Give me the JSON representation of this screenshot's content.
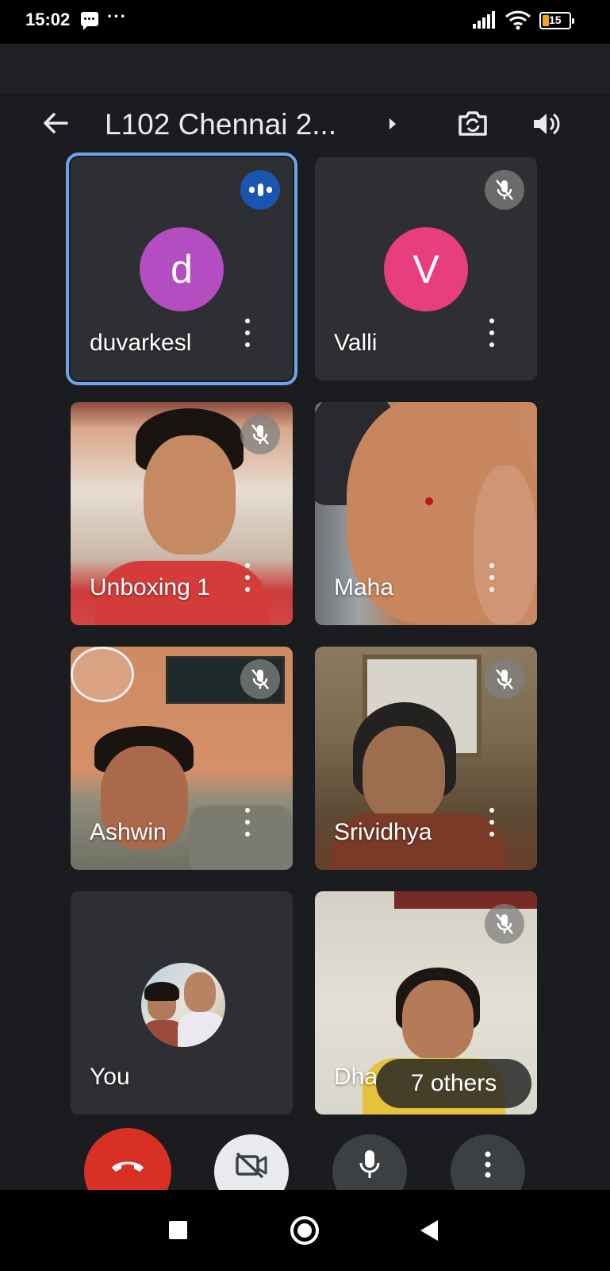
{
  "status_bar": {
    "time": "15:02",
    "battery_level": "15",
    "battery_color": "#f5a623"
  },
  "header": {
    "title": "L102 Chennai 2...",
    "back_icon": "arrow-left-icon",
    "switch_camera_icon": "switch-camera-icon",
    "speaker_icon": "volume-icon"
  },
  "participants": [
    {
      "name": "duvarkesl",
      "avatar_letter": "d",
      "avatar_color": "#b34dc1",
      "status": "speaking",
      "active": true
    },
    {
      "name": "Valli",
      "avatar_letter": "V",
      "avatar_color": "#e83e7b",
      "status": "muted"
    },
    {
      "name": "Unboxing 1",
      "status": "muted",
      "video": true
    },
    {
      "name": "Maha",
      "status": "unmuted",
      "video": true
    },
    {
      "name": "Ashwin",
      "status": "muted",
      "video": true
    },
    {
      "name": "Srividhya",
      "status": "muted",
      "video": true
    },
    {
      "name": "You",
      "status": "self"
    },
    {
      "name": "Dha",
      "status": "muted",
      "video": true
    }
  ],
  "others_chip": "7 others",
  "controls": {
    "end_call": "phone-hangup-icon",
    "camera": "camera-off-icon",
    "mic": "microphone-icon",
    "more": "more-vert-icon"
  },
  "accent_color": "#6ea2ea"
}
